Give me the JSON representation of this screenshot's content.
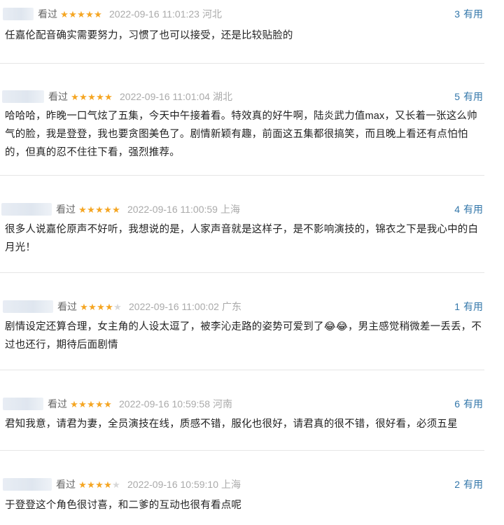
{
  "reviews": [
    {
      "watched_label": "看过",
      "rating": 5,
      "time": "2022-09-16 11:01:23",
      "location": "河北",
      "useful_count": "3",
      "useful_label": "有用",
      "content": "任嘉伦配音确实需要努力，习惯了也可以接受，还是比较贴脸的"
    },
    {
      "watched_label": "看过",
      "rating": 5,
      "time": "2022-09-16 11:01:04",
      "location": "湖北",
      "useful_count": "5",
      "useful_label": "有用",
      "content": "哈哈哈，昨晚一口气炫了五集，今天中午接着看。特效真的好牛啊，陆炎武力值max，又长着一张这么帅气的脸，我是登登，我也要贪图美色了。剧情新颖有趣，前面这五集都很搞笑，而且晚上看还有点怕怕的，但真的忍不住往下看，强烈推荐。"
    },
    {
      "watched_label": "看过",
      "rating": 5,
      "time": "2022-09-16 11:00:59",
      "location": "上海",
      "useful_count": "4",
      "useful_label": "有用",
      "content": "很多人说嘉伦原声不好听，我想说的是，人家声音就是这样子，是不影响演技的，锦衣之下是我心中的白月光！"
    },
    {
      "watched_label": "看过",
      "rating": 4,
      "time": "2022-09-16 11:00:02",
      "location": "广东",
      "useful_count": "1",
      "useful_label": "有用",
      "content": "剧情设定还算合理，女主角的人设太逗了，被李沁走路的姿势可爱到了😂😂，男主感觉稍微差一丢丢，不过也还行，期待后面剧情"
    },
    {
      "watched_label": "看过",
      "rating": 5,
      "time": "2022-09-16 10:59:58",
      "location": "河南",
      "useful_count": "6",
      "useful_label": "有用",
      "content": "君知我意，请君为妻，全员演技在线，质感不错，服化也很好，请君真的很不错，很好看，必须五星"
    },
    {
      "watched_label": "看过",
      "rating": 4,
      "time": "2022-09-16 10:59:10",
      "location": "上海",
      "useful_count": "2",
      "useful_label": "有用",
      "content": "于登登这个角色很讨喜，和二爹的互动也很有看点呢"
    }
  ],
  "colors": {
    "star_full": "#f5a623",
    "star_empty": "#d8d8d8",
    "useful": "#3377aa",
    "meta": "#999999",
    "divider": "#e6e6e6"
  }
}
